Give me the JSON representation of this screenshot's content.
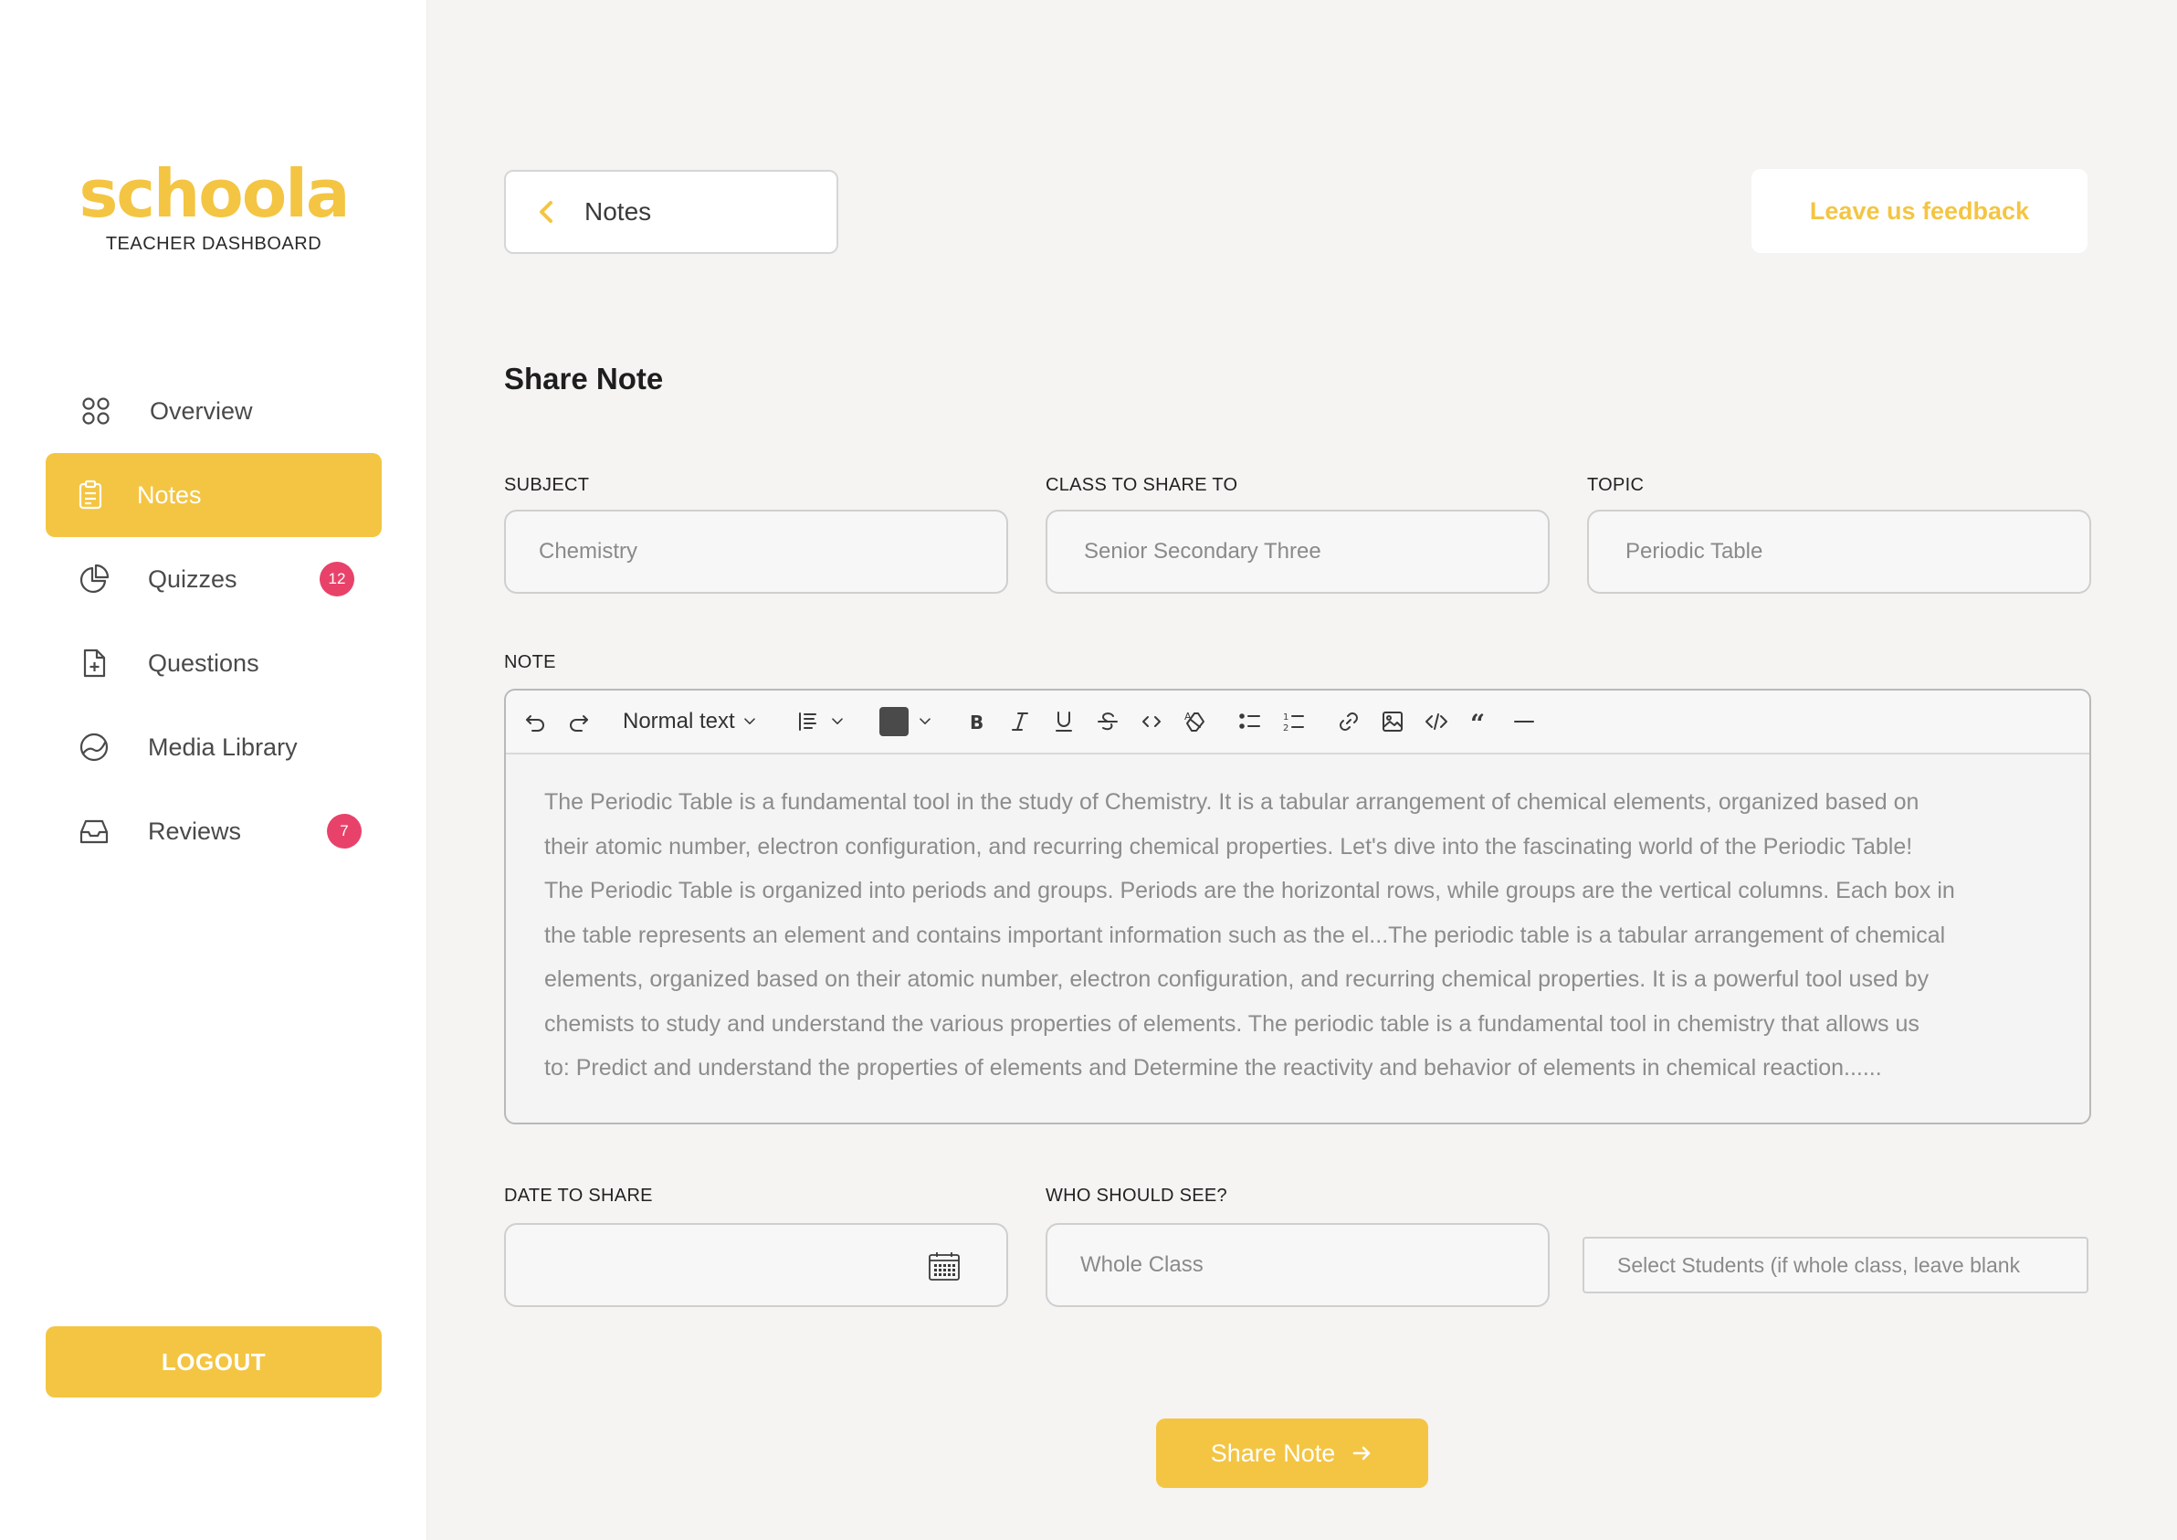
{
  "sidebar": {
    "logo": "schoola",
    "subtitle": "TEACHER DASHBOARD",
    "items": [
      {
        "label": "Overview",
        "icon": "grid-icon"
      },
      {
        "label": "Notes",
        "icon": "clipboard-icon",
        "active": true
      },
      {
        "label": "Quizzes",
        "icon": "pie-chart-icon",
        "badge": "12"
      },
      {
        "label": "Questions",
        "icon": "file-plus-icon"
      },
      {
        "label": "Media Library",
        "icon": "gauge-icon"
      },
      {
        "label": "Reviews",
        "icon": "inbox-icon",
        "badge": "7"
      }
    ],
    "logout_label": "LOGOUT"
  },
  "header": {
    "back_label": "Notes",
    "feedback_label": "Leave us feedback"
  },
  "page_title": "Share Note",
  "form": {
    "subject_label": "SUBJECT",
    "subject_value": "Chemistry",
    "class_label": "CLASS TO SHARE TO",
    "class_value": "Senior Secondary Three",
    "topic_label": "TOPIC",
    "topic_value": "Periodic Table",
    "note_label": "NOTE",
    "toolbar": {
      "block_style": "Normal text",
      "text_color": "#4a4a4a"
    },
    "note_lines": [
      "The Periodic Table is a fundamental tool in the study of Chemistry. It is a tabular arrangement of chemical elements, organized based on",
      "their atomic number, electron configuration, and recurring chemical properties. Let's dive into the fascinating world of the Periodic Table!",
      "The Periodic Table is organized into periods and groups. Periods are the horizontal rows, while groups are the vertical columns. Each box in",
      "the table represents an element and contains important information such as the el...The periodic table is a tabular arrangement of chemical",
      "elements, organized based on their atomic number, electron configuration, and recurring chemical properties. It is a powerful tool used by",
      "chemists to study and understand the various properties of elements. The periodic table is a fundamental tool in chemistry that allows us",
      "to: Predict and understand the properties of elements and Determine the reactivity and behavior of elements in chemical reaction......"
    ],
    "date_label": "DATE TO SHARE",
    "date_value": "",
    "who_label": "WHO SHOULD SEE?",
    "who_value": "Whole Class",
    "students_placeholder": "Select Students (if whole class, leave blank",
    "submit_label": "Share Note"
  },
  "colors": {
    "accent": "#f4c543",
    "badge": "#e8426a",
    "background": "#f5f4f3"
  }
}
